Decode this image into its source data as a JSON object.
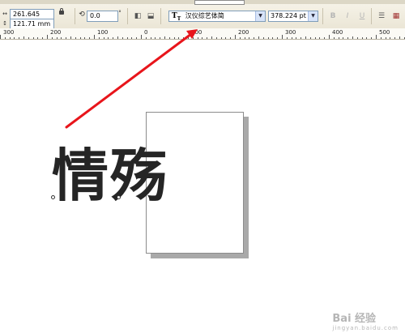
{
  "property_bar": {
    "width_value": "261.645 mm",
    "height_value": "121.71 mm",
    "rotation_value": "0.0",
    "rotation_unit": "°",
    "font_name": "汉仪综艺体简",
    "font_size": "378.224 pt"
  },
  "ruler": {
    "labels": [
      "300",
      "200",
      "100",
      "0",
      "100",
      "200",
      "300",
      "400",
      "500"
    ]
  },
  "canvas": {
    "text": "情殇"
  },
  "annotation": {
    "arrow_color": "#e8151b"
  },
  "watermark": {
    "text": "Bai 经验",
    "sub": "jingyan.baidu.com"
  }
}
